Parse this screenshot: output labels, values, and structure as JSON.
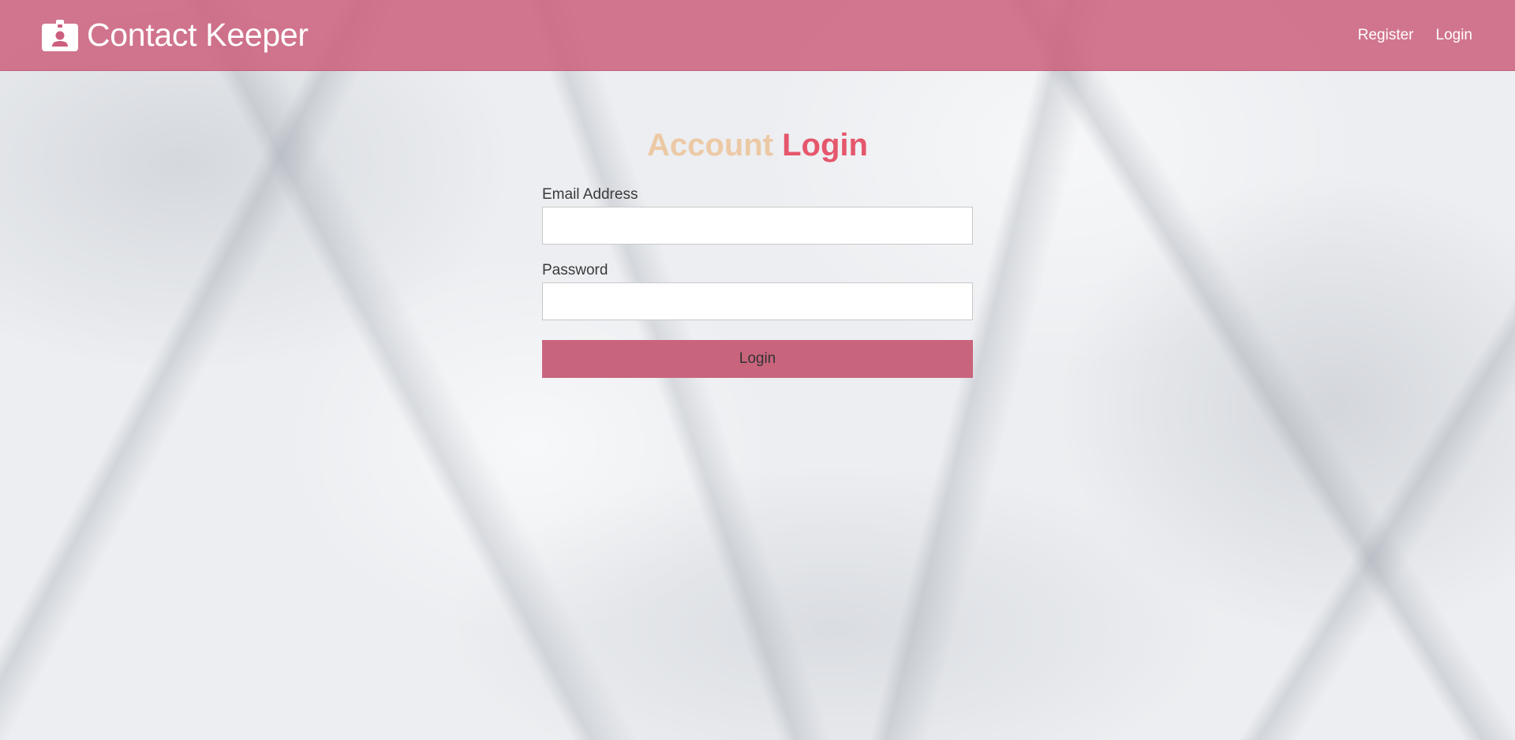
{
  "navbar": {
    "brand_icon": "id-badge-icon",
    "title": "Contact Keeper",
    "links": [
      {
        "label": "Register"
      },
      {
        "label": "Login"
      }
    ],
    "background_color": "#cc5f7d"
  },
  "form": {
    "heading_part1": "Account",
    "heading_part2": "Login",
    "heading_part1_color": "#ecc9a5",
    "heading_part2_color": "#e5576c",
    "email": {
      "label": "Email Address",
      "value": ""
    },
    "password": {
      "label": "Password",
      "value": ""
    },
    "submit_label": "Login",
    "submit_color": "#c9647d"
  }
}
